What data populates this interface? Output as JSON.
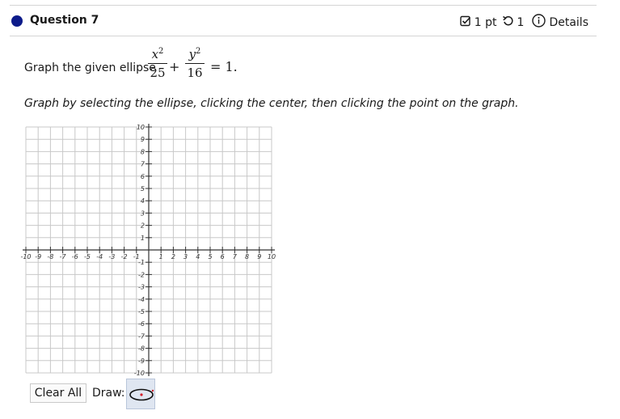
{
  "question": {
    "title": "Question 7"
  },
  "meta": {
    "points": "1 pt",
    "attempts": "1",
    "details": "Details"
  },
  "prompt": {
    "text": "Graph the given ellipse",
    "x_numerator": "x",
    "x_power": "2",
    "x_denominator": "25",
    "plus": "+",
    "y_numerator": "y",
    "y_power": "2",
    "y_denominator": "16",
    "equals_rhs": "= 1."
  },
  "instructions": "Graph by selecting the ellipse, clicking the center, then clicking the point on the graph.",
  "graph": {
    "x_range": [
      -10,
      10
    ],
    "y_range": [
      -10,
      10
    ],
    "x_tick_labels": [
      "-10",
      "-9",
      "-8",
      "-7",
      "-6",
      "-5",
      "-4",
      "-3",
      "-2",
      "-1",
      "1",
      "2",
      "3",
      "4",
      "5",
      "6",
      "7",
      "8",
      "9",
      "10"
    ],
    "y_tick_labels": [
      "10",
      "9",
      "8",
      "7",
      "6",
      "5",
      "4",
      "3",
      "2",
      "1",
      "-1",
      "-2",
      "-3",
      "-4",
      "-5",
      "-6",
      "-7",
      "-8",
      "-9",
      "-10"
    ],
    "grid": true,
    "grid_color": "#c8c8c8",
    "axis_color": "#333333"
  },
  "toolbar": {
    "clear_label": "Clear All",
    "draw_label": "Draw:",
    "tool_icon": "ellipse-tool-icon"
  },
  "colors": {
    "question_dot": "#0d1b8a",
    "tool_bg": "#dfe6f1",
    "tool_dot": "#d21f2b"
  }
}
